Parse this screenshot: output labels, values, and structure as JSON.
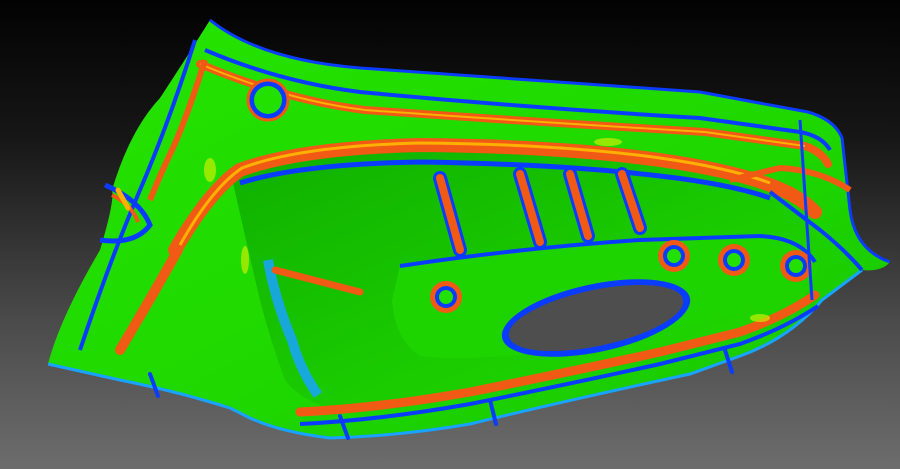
{
  "scene": {
    "subject": "curvature-analysis-panel",
    "colors": {
      "background_top": "#020202",
      "background_bottom": "#6d6d6d",
      "surface_flat": "#22e000",
      "surface_flat_dark": "#12b800",
      "ridge_high": "#f05a14",
      "ridge_peak": "#ffb000",
      "trough_low": "#0a3cff",
      "trough_mid": "#17a3ff",
      "transition": "#c8f000"
    },
    "features": {
      "mounting_holes": 4,
      "rib_slots": 4,
      "oval_cutouts": 1
    }
  }
}
